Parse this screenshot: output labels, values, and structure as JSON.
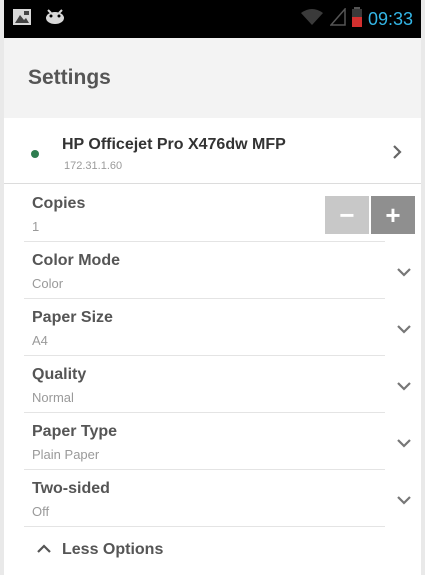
{
  "status_bar": {
    "time": "09:33",
    "icons": [
      "notification-image-icon",
      "android-debug-icon",
      "wifi-icon",
      "signal-icon",
      "battery-low-icon"
    ]
  },
  "header": {
    "title": "Settings"
  },
  "printer": {
    "name": "HP Officejet Pro X476dw MFP",
    "ip": "172.31.1.60",
    "status_color": "#2e7d4f"
  },
  "settings": {
    "copies": {
      "label": "Copies",
      "value": "1"
    },
    "color_mode": {
      "label": "Color Mode",
      "value": "Color"
    },
    "paper_size": {
      "label": "Paper Size",
      "value": "A4"
    },
    "quality": {
      "label": "Quality",
      "value": "Normal"
    },
    "paper_type": {
      "label": "Paper Type",
      "value": "Plain Paper"
    },
    "two_sided": {
      "label": "Two-sided",
      "value": "Off"
    }
  },
  "stepper": {
    "minus": "−",
    "plus": "+"
  },
  "footer": {
    "less_options": "Less Options"
  },
  "colors": {
    "accent": "#33b5e5",
    "status_green": "#2e7d4f"
  }
}
